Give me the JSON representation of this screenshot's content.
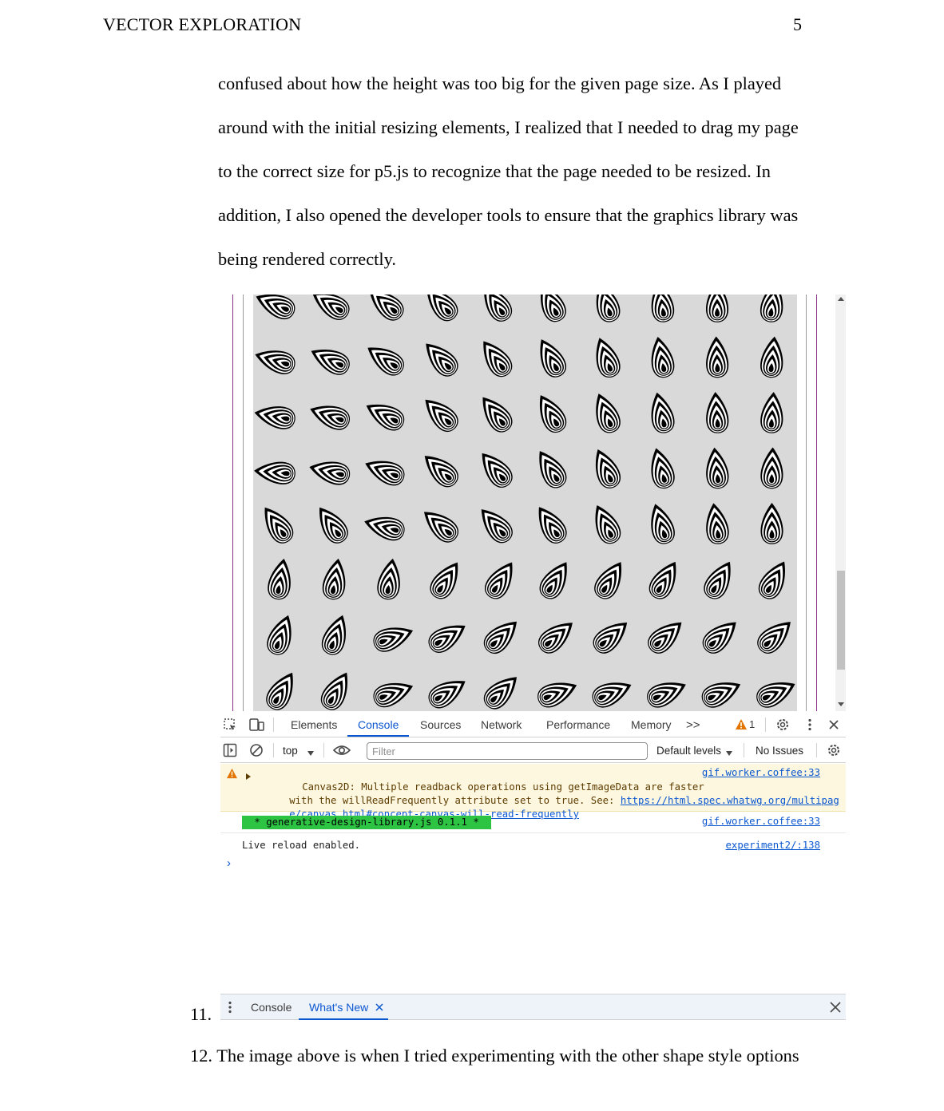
{
  "header": {
    "running_head": "VECTOR EXPLORATION",
    "page_number": "5"
  },
  "paragraph_lines": [
    "confused about how the height was too big for the given page size. As I played",
    "around with the initial resizing elements, I realized that I needed to drag my page",
    "to the correct size for p5.js to recognize that the page needed to be resized. In",
    "addition, I also opened the developer tools to ensure that the graphics library was",
    "being rendered correctly."
  ],
  "devtools": {
    "tabs": [
      "Elements",
      "Console",
      "Sources",
      "Network",
      "Performance",
      "Memory"
    ],
    "active_tab": "Console",
    "more_tabs_icon": ">>",
    "warning_count": "1",
    "toolbar": {
      "context": "top",
      "filter_placeholder": "Filter",
      "levels": "Default levels",
      "issues": "No Issues"
    },
    "console": {
      "warning": {
        "line1": "Canvas2D: Multiple readback operations using getImageData are faster",
        "line2_prefix": "with the willReadFrequently attribute set to true. See: ",
        "link_part1": "https://html.spec.whatwg.org/multipag",
        "link_part2": "e/canvas.html#concept-canvas-will-read-frequently",
        "source": "gif.worker.coffee:33"
      },
      "library_log": {
        "text": " * generative-design-library.js 0.1.1 * ",
        "source": "gif.worker.coffee:33"
      },
      "reload_log": {
        "text": "Live reload enabled.",
        "source": "experiment2/:138"
      }
    },
    "drawer": {
      "tabs": [
        "Console",
        "What's New"
      ],
      "active_tab": "What's New"
    }
  },
  "list": {
    "item11_number": "11.",
    "item12_number": "12.",
    "item12_text": "The image above is when I tried experimenting with the other shape style options"
  },
  "colors": {
    "canvas_bg": "#d9d9d9",
    "shape": "#000000",
    "accent_blue": "#0b57d0",
    "warning_bg": "#fef7e0",
    "warning_icon": "#e37400",
    "badge_green": "#2ec443",
    "page_border_purple": "#8b2d8b"
  }
}
